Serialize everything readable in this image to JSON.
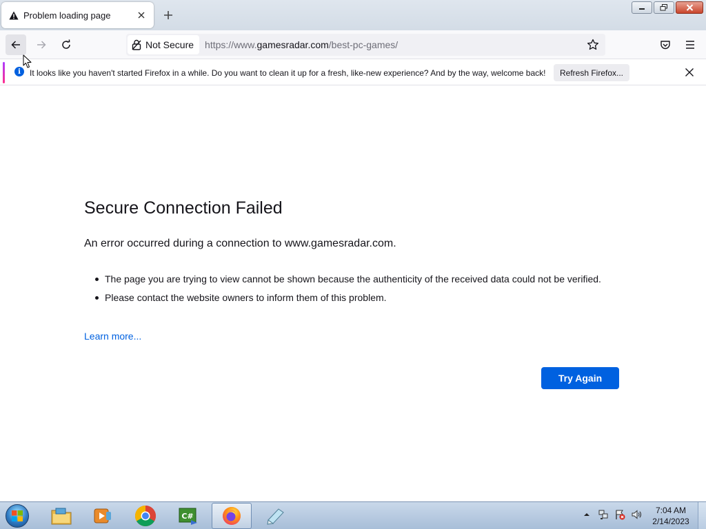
{
  "tab": {
    "title": "Problem loading page",
    "icon": "warning-icon"
  },
  "window_controls": [
    "minimize",
    "restore",
    "close"
  ],
  "navbar": {
    "security_label": "Not Secure",
    "url_prefix": "https://www.",
    "url_host": "gamesradar.com",
    "url_path": "/best-pc-games/"
  },
  "notification": {
    "message": "It looks like you haven't started Firefox in a while. Do you want to clean it up for a fresh, like-new experience? And by the way, welcome back!",
    "refresh_label": "Refresh Firefox..."
  },
  "error": {
    "title": "Secure Connection Failed",
    "short_desc": "An error occurred during a connection to www.gamesradar.com.",
    "bullets": [
      "The page you are trying to view cannot be shown because the authenticity of the received data could not be verified.",
      "Please contact the website owners to inform them of this problem."
    ],
    "learn_more": "Learn more...",
    "try_again": "Try Again"
  },
  "taskbar": {
    "items": [
      "file-explorer-icon",
      "media-player-icon",
      "chrome-icon",
      "csharp-icon",
      "firefox-icon",
      "notepad-icon"
    ],
    "active_item": "firefox-icon",
    "clock_time": "7:04 AM",
    "clock_date": "2/14/2023"
  },
  "colors": {
    "accent_blue": "#0061e0",
    "info_blue": "#0060df",
    "text": "#15141a",
    "url_muted": "#6e6e78"
  }
}
